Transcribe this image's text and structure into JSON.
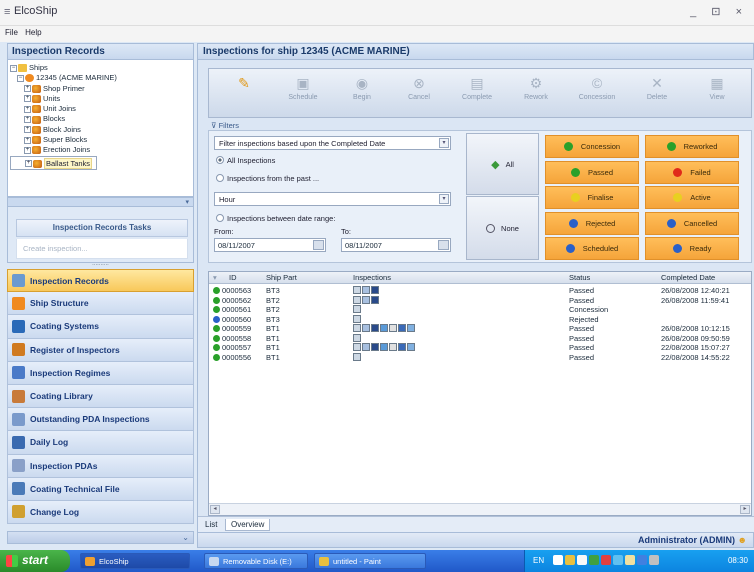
{
  "window": {
    "title": "ElcoShip",
    "controls": "_ ⊡ ×"
  },
  "menu": [
    "File",
    "Help"
  ],
  "left_panel": {
    "title": "Inspection Records",
    "tree": {
      "root": "Ships",
      "ship": "12345 (ACME MARINE)",
      "children": [
        "Shop Primer",
        "Units",
        "Unit Joins",
        "Blocks",
        "Block Joins",
        "Super Blocks",
        "Erection Joins",
        "Ballast Tanks"
      ],
      "selected": "Ballast Tanks"
    },
    "tasks_title": "Inspection Records Tasks",
    "tasks_link": "Create inspection...",
    "grip": "..........",
    "nav": [
      {
        "label": "Inspection Records",
        "icon": "magnifier-icon",
        "color": "#6a9ad0",
        "active": true
      },
      {
        "label": "Ship Structure",
        "icon": "ship-structure-icon",
        "color": "#f08a20"
      },
      {
        "label": "Coating Systems",
        "icon": "grid-icon",
        "color": "#2a6ab8"
      },
      {
        "label": "Register of Inspectors",
        "icon": "inspector-icon",
        "color": "#d07a20"
      },
      {
        "label": "Inspection Regimes",
        "icon": "regime-icon",
        "color": "#4a7ac8"
      },
      {
        "label": "Coating Library",
        "icon": "library-icon",
        "color": "#c87a3a"
      },
      {
        "label": "Outstanding PDA Inspections",
        "icon": "pda-search-icon",
        "color": "#7a9acb"
      },
      {
        "label": "Daily Log",
        "icon": "log-icon",
        "color": "#3a6ab0"
      },
      {
        "label": "Inspection PDAs",
        "icon": "pda-icon",
        "color": "#8aa0c8"
      },
      {
        "label": "Coating Technical File",
        "icon": "file-icon",
        "color": "#4a7ab8"
      },
      {
        "label": "Change Log",
        "icon": "change-log-icon",
        "color": "#d0a030"
      }
    ]
  },
  "main": {
    "title": "Inspections for ship 12345 (ACME MARINE)",
    "toolbar": [
      {
        "label": "",
        "icon": "new-inspection-icon",
        "glyph": "✎",
        "primary": true
      },
      {
        "label": "Schedule",
        "icon": "schedule-icon",
        "glyph": "▣"
      },
      {
        "label": "Begin",
        "icon": "begin-icon",
        "glyph": "◉"
      },
      {
        "label": "Cancel",
        "icon": "cancel-icon",
        "glyph": "⊗"
      },
      {
        "label": "Complete",
        "icon": "complete-icon",
        "glyph": "▤"
      },
      {
        "label": "Rework",
        "icon": "rework-icon",
        "glyph": "⚙"
      },
      {
        "label": "Concession",
        "icon": "concession-icon",
        "glyph": "©"
      },
      {
        "label": "Delete",
        "icon": "delete-icon",
        "glyph": "✕"
      },
      {
        "label": "View",
        "icon": "view-icon",
        "glyph": "▦"
      }
    ],
    "filters": {
      "label": "Filters",
      "filter_select": "Filter inspections based upon the Completed Date",
      "radio_all": "All Inspections",
      "radio_past": "Inspections from the past ...",
      "past_unit": "Hour",
      "radio_range": "Inspections between date range:",
      "from_label": "From:",
      "to_label": "To:",
      "from_value": "08/11/2007",
      "to_value": "08/11/2007",
      "all_button": "All",
      "none_button": "None",
      "status_buttons": [
        {
          "label": "Concession",
          "dot": "#2aa02a"
        },
        {
          "label": "Reworked",
          "dot": "#2aa02a"
        },
        {
          "label": "Passed",
          "dot": "#2aa02a"
        },
        {
          "label": "Failed",
          "dot": "#e02a1a"
        },
        {
          "label": "Finalise",
          "dot": "#e8d020"
        },
        {
          "label": "Active",
          "dot": "#e8d020"
        },
        {
          "label": "Rejected",
          "dot": "#2a60c8"
        },
        {
          "label": "Cancelled",
          "dot": "#2a60c8"
        },
        {
          "label": "Scheduled",
          "dot": "#2a60c8"
        },
        {
          "label": "Ready",
          "dot": "#2a60c8"
        }
      ]
    },
    "grid": {
      "columns": [
        "ID",
        "Ship Part",
        "Inspections",
        "Status",
        "Completed Date"
      ],
      "rows": [
        {
          "id": "0000563",
          "part": "BT3",
          "icons": 3,
          "status": "Passed",
          "date": "26/08/2008 12:40:21",
          "dot": "#2aa02a"
        },
        {
          "id": "0000562",
          "part": "BT2",
          "icons": 3,
          "status": "Passed",
          "date": "26/08/2008 11:59:41",
          "dot": "#2aa02a"
        },
        {
          "id": "0000561",
          "part": "BT2",
          "icons": 1,
          "status": "Concession",
          "date": "",
          "dot": "#2aa02a"
        },
        {
          "id": "0000560",
          "part": "BT3",
          "icons": 1,
          "status": "Rejected",
          "date": "",
          "dot": "#2a60c8"
        },
        {
          "id": "0000559",
          "part": "BT1",
          "icons": 7,
          "status": "Passed",
          "date": "26/08/2008 10:12:15",
          "dot": "#2aa02a"
        },
        {
          "id": "0000558",
          "part": "BT1",
          "icons": 1,
          "status": "Passed",
          "date": "26/08/2008 09:50:59",
          "dot": "#2aa02a"
        },
        {
          "id": "0000557",
          "part": "BT1",
          "icons": 7,
          "status": "Passed",
          "date": "22/08/2008 15:07:27",
          "dot": "#2aa02a"
        },
        {
          "id": "0000556",
          "part": "BT1",
          "icons": 1,
          "status": "Passed",
          "date": "22/08/2008 14:55:22",
          "dot": "#2aa02a"
        }
      ]
    },
    "tabs": [
      "List",
      "Overview"
    ]
  },
  "statusbar": {
    "user": "Administrator (ADMIN)"
  },
  "taskbar": {
    "start": "start",
    "items": [
      {
        "label": "ElcoShip",
        "active": true
      },
      {
        "label": "Removable Disk (E:)"
      },
      {
        "label": "untitled - Paint"
      }
    ],
    "lang": "EN",
    "clock": "08:30"
  }
}
